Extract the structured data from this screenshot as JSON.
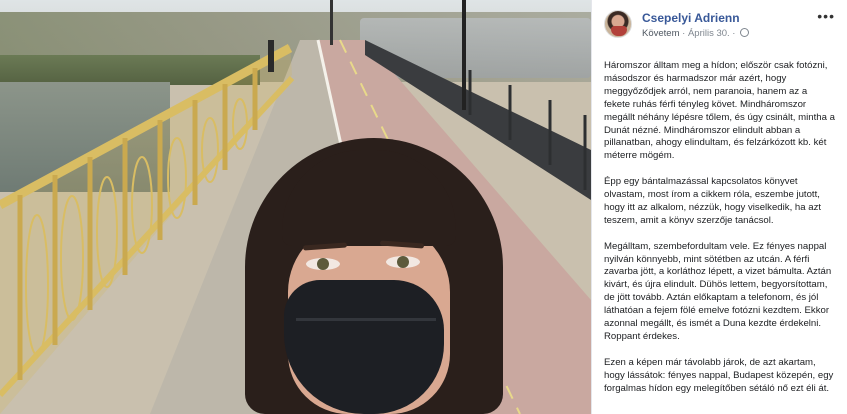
{
  "post": {
    "author": "Csepelyi Adrienn",
    "follow_label": "Követem",
    "separator": " · ",
    "date": "Április 30.",
    "more_label": "•••",
    "paragraphs": [
      "Háromszor álltam meg a hídon; először csak fotózni, másodszor és harmadszor már azért, hogy meggyőződjek arról, nem paranoia, hanem az a fekete ruhás férfi tényleg követ. Mindháromszor megállt néhány lépésre tőlem, és úgy csinált, mintha a Dunát nézné. Mindháromszor elindult abban a pillanatban, ahogy elindultam, és felzárkózott kb. két méterre mögém.",
      "Épp egy bántalmazással kapcsolatos könyvet olvastam, most írom a cikkem róla, eszembe jutott, hogy itt az alkalom, nézzük, hogy viselkedik, ha azt teszem, amit a könyv szerzője tanácsol.",
      "Megálltam, szembefordultam vele. Ez fényes nappal nyilván könnyebb, mint sötétben az utcán. A férfi zavarba jött, a korláthoz lépett, a vizet bámulta. Aztán kivárt, és újra elindult. Dühös lettem, begyorsítottam, de jött tovább. Aztán előkaptam a telefonom, és jól láthatóan a fejem fölé emelve fotózni kezdtem. Ekkor azonnal megállt, és ismét a Duna kezdte érdekelni. Roppant érdekes.",
      "Ezen a képen már távolabb járok, de azt akartam, hogy lássátok: fényes nappal, Budapest közepén, egy forgalmas hídon egy melegítőben sétáló nő ezt éli át."
    ]
  },
  "colors": {
    "author_link": "#385898",
    "meta_text": "#7f868f",
    "body_text": "#1c1e21",
    "railing": "#d4b85e"
  },
  "icons": {
    "visibility": "globe-icon",
    "options": "more-options-icon"
  }
}
